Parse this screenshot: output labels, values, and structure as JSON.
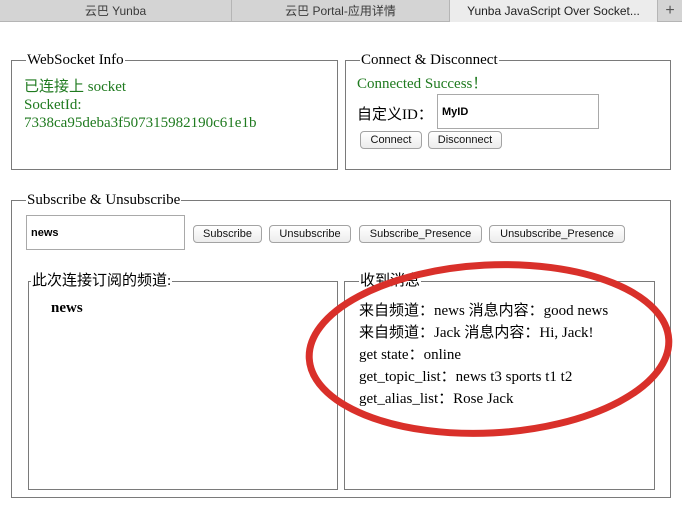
{
  "tabs": [
    {
      "title": "云巴 Yunba"
    },
    {
      "title": "云巴 Portal-应用详情"
    },
    {
      "title": "Yunba JavaScript Over Socket..."
    }
  ],
  "new_tab_label": "+",
  "websocket_info": {
    "legend": "WebSocket Info",
    "status": "已连接上 socket",
    "socket_id_label": "SocketId:",
    "socket_id": "7338ca95deba3f507315982190c61e1b"
  },
  "connect": {
    "legend": "Connect & Disconnect",
    "status": "Connected Success！",
    "custom_id_label": "自定义ID：",
    "custom_id_value": "MyID",
    "connect_label": "Connect",
    "disconnect_label": "Disconnect"
  },
  "subscribe": {
    "legend": "Subscribe & Unsubscribe",
    "topic_value": "news",
    "subscribe_label": "Subscribe",
    "unsubscribe_label": "Unsubscribe",
    "subscribe_presence_label": "Subscribe_Presence",
    "unsubscribe_presence_label": "Unsubscribe_Presence"
  },
  "channels": {
    "legend": "此次连接订阅的频道:",
    "items": [
      "news"
    ]
  },
  "messages": {
    "legend": "收到消息",
    "lines": [
      "来自频道：news   消息内容：good news",
      "来自频道：Jack   消息内容：Hi, Jack!",
      "get state：online",
      "get_topic_list：news t3 sports t1 t2",
      "get_alias_list：Rose Jack"
    ]
  },
  "colors": {
    "status_green": "#1f7a1f",
    "annotation_red": "#d9302a"
  }
}
